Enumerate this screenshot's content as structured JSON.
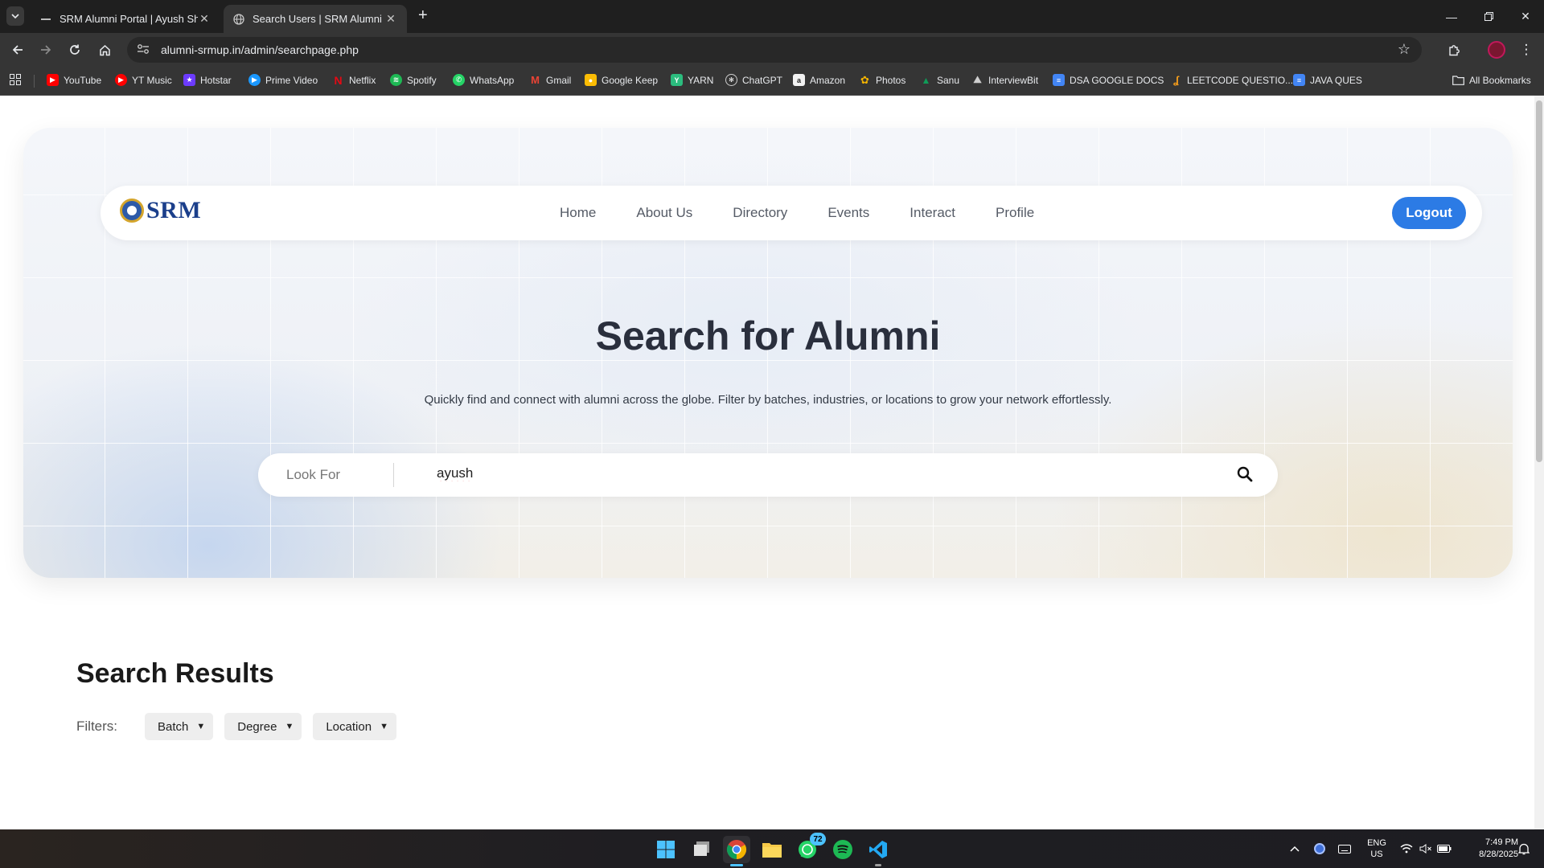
{
  "browser": {
    "tabs": [
      {
        "title": "SRM Alumni Portal | Ayush Sha",
        "active": false
      },
      {
        "title": "Search Users | SRM Alumni",
        "active": true
      }
    ],
    "url": "alumni-srmup.in/admin/searchpage.php",
    "bookmarks": [
      {
        "label": "YouTube",
        "icon": "youtube-icon",
        "color": "#ff0000"
      },
      {
        "label": "YT Music",
        "icon": "yt-music-icon",
        "color": "#ff0000"
      },
      {
        "label": "Hotstar",
        "icon": "hotstar-icon",
        "color": "#6c3bff"
      },
      {
        "label": "Prime Video",
        "icon": "prime-video-icon",
        "color": "#1a98ff"
      },
      {
        "label": "Netflix",
        "icon": "netflix-icon",
        "color": "#e50914"
      },
      {
        "label": "Spotify",
        "icon": "spotify-icon",
        "color": "#1db954"
      },
      {
        "label": "WhatsApp",
        "icon": "whatsapp-icon",
        "color": "#25d366"
      },
      {
        "label": "Gmail",
        "icon": "gmail-icon",
        "color": "#ea4335"
      },
      {
        "label": "Google Keep",
        "icon": "google-keep-icon",
        "color": "#fbbc04"
      },
      {
        "label": "YARN",
        "icon": "yarn-icon",
        "color": "#2bbc7e"
      },
      {
        "label": "ChatGPT",
        "icon": "chatgpt-icon",
        "color": "#555555"
      },
      {
        "label": "Amazon",
        "icon": "amazon-icon",
        "color": "#222222"
      },
      {
        "label": "Photos",
        "icon": "google-photos-icon",
        "color": "#f4b400"
      },
      {
        "label": "Sanu",
        "icon": "google-drive-icon",
        "color": "#0f9d58"
      },
      {
        "label": "InterviewBit",
        "icon": "interviewbit-icon",
        "color": "#2e7d32"
      },
      {
        "label": "DSA GOOGLE DOCS",
        "icon": "google-docs-icon",
        "color": "#4285f4"
      },
      {
        "label": "LEETCODE QUESTIO...",
        "icon": "leetcode-icon",
        "color": "#f89f1b"
      },
      {
        "label": "JAVA QUES",
        "icon": "google-docs-icon",
        "color": "#4285f4"
      }
    ],
    "all_bookmarks": "All Bookmarks"
  },
  "navbar": {
    "logo_text": "SRM",
    "links": [
      "Home",
      "About Us",
      "Directory",
      "Events",
      "Interact",
      "Profile"
    ],
    "logout": "Logout"
  },
  "hero": {
    "title": "Search for Alumni",
    "subtitle": "Quickly find and connect with alumni across the globe. Filter by batches, industries, or locations to grow your network effortlessly."
  },
  "search": {
    "label": "Look For",
    "value": "ayush"
  },
  "results": {
    "title": "Search Results",
    "filters_label": "Filters:",
    "filters": [
      "Batch",
      "Degree",
      "Location"
    ]
  },
  "taskbar": {
    "whatsapp_badge": "72",
    "lang_top": "ENG",
    "lang_bottom": "US",
    "time": "7:49 PM",
    "date": "8/28/2025"
  }
}
